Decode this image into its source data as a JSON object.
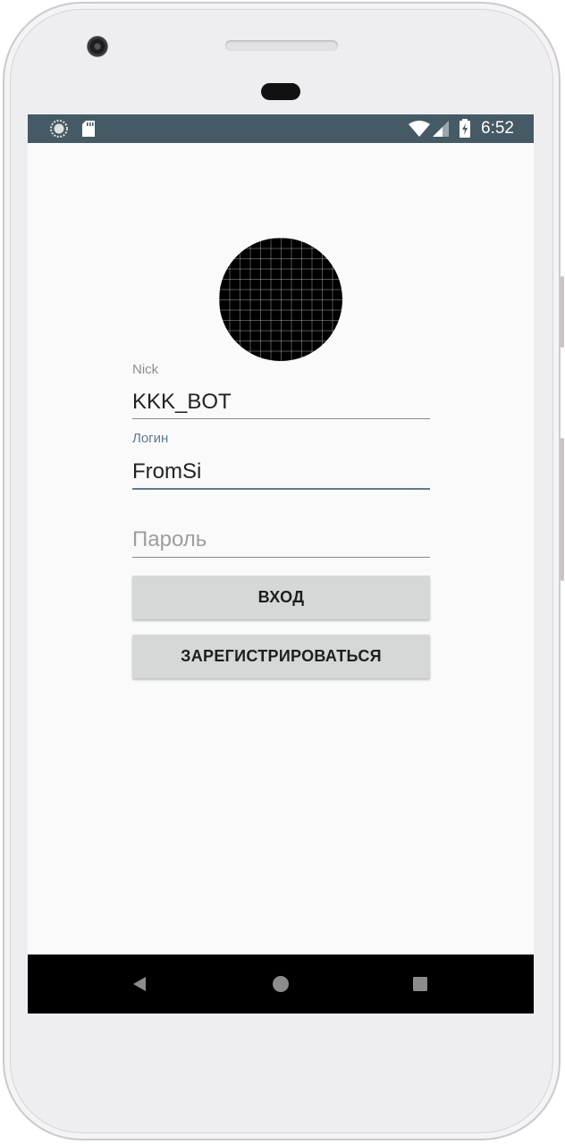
{
  "status_bar": {
    "time": "6:52",
    "left_icons": [
      "sync-icon",
      "sd-card-icon"
    ],
    "right_icons": [
      "wifi-icon",
      "signal-icon",
      "battery-icon"
    ],
    "background": "#455a64"
  },
  "avatar": {
    "icon": "grid-avatar-icon"
  },
  "form": {
    "nick": {
      "label": "Nick",
      "value": "KKK_BOT"
    },
    "login": {
      "label": "Логин",
      "value": "FromSi",
      "label_color": "#5e7b8c"
    },
    "password": {
      "label": "",
      "placeholder": "Пароль",
      "value": ""
    }
  },
  "buttons": {
    "login_label": "ВХОД",
    "register_label": "ЗАРЕГИСТРИРОВАТЬСЯ"
  },
  "nav_bar": {
    "buttons": [
      "back-icon",
      "home-icon",
      "recents-icon"
    ]
  }
}
